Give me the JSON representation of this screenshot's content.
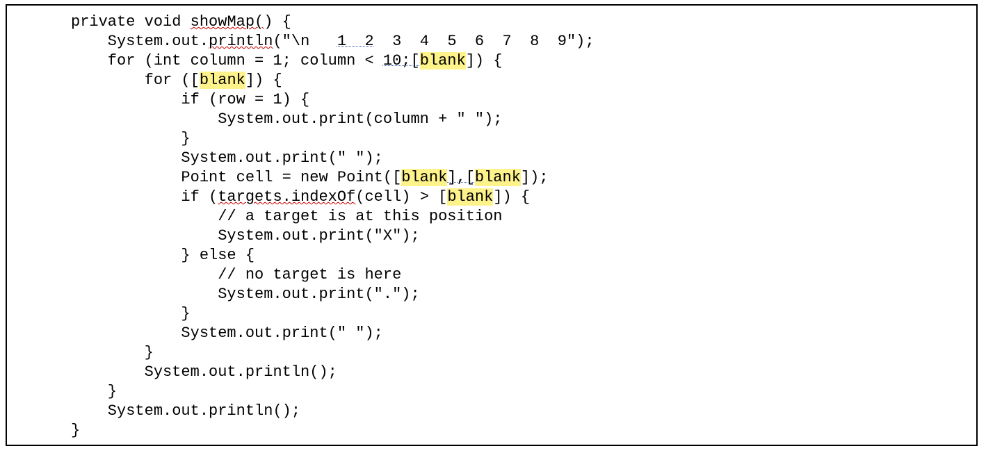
{
  "code": {
    "l01_a": "private void ",
    "l01_b": "showMap(",
    "l01_c": ") {",
    "l02_a": "    System.out.",
    "l02_b": "println",
    "l02_c": "(\"\\n   ",
    "l02_d": "1  2",
    "l02_e": "  3  4  5  6  7  8  9\");",
    "l03_a": "    for (int column = 1; column < ",
    "l03_b": "10;[",
    "l03_c": "blank",
    "l03_d": "]) {",
    "l04_a": "        for ([",
    "l04_b": "blank",
    "l04_c": "]) {",
    "l05": "            if (row = 1) {",
    "l06": "                System.out.print(column + \" \");",
    "l07": "            }",
    "l08": "            System.out.print(\" \");",
    "l09_a": "            Point cell = new Point([",
    "l09_b": "blank",
    "l09_c": "],[",
    "l09_d": "blank",
    "l09_e": "]);",
    "l10_a": "            if (",
    "l10_b": "targets.indexOf",
    "l10_c": "(cell) > [",
    "l10_d": "blank",
    "l10_e": "]) {",
    "l11": "                // a target is at this position",
    "l12": "                System.out.print(\"X\");",
    "l13": "            } else {",
    "l14": "                // no target is here",
    "l15": "                System.out.print(\".\");",
    "l16": "            }",
    "l17": "            System.out.print(\" \");",
    "l18": "        }",
    "l19": "        System.out.println();",
    "l20": "    }",
    "l21": "    System.out.println();",
    "l22": "}"
  }
}
